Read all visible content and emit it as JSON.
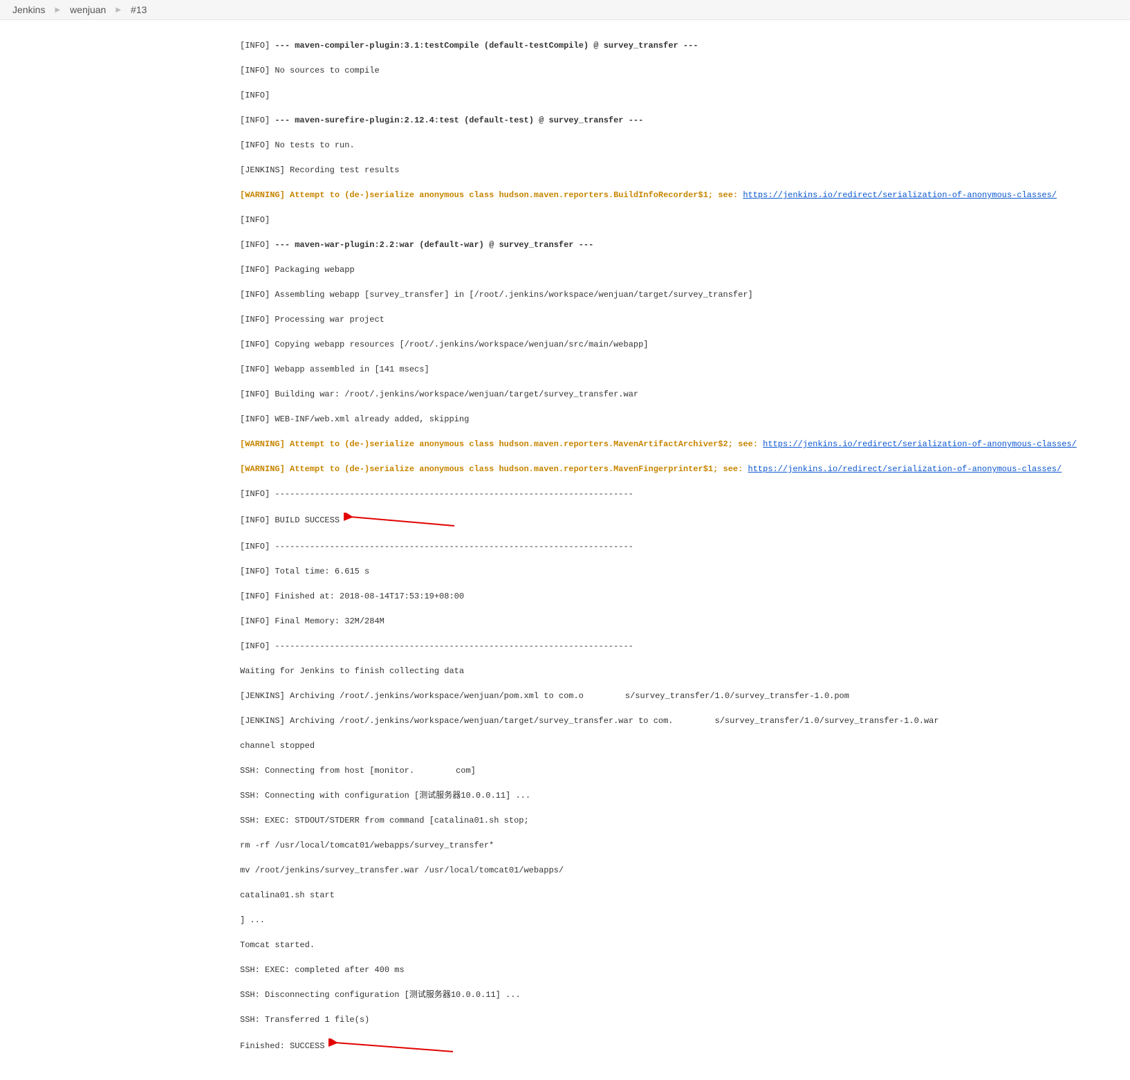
{
  "breadcrumb": {
    "items": [
      "Jenkins",
      "wenjuan",
      "#13"
    ]
  },
  "tags": {
    "info": "[INFO]",
    "jenkins": "[JENKINS]",
    "warning": "[WARNING]"
  },
  "lines": {
    "l1a": "--- ",
    "l1b": "maven-compiler-plugin:3.1:testCompile (default-testCompile) @ survey_transfer",
    "l1c": " ---",
    "l2": "No sources to compile",
    "l3a": "--- ",
    "l3b": "maven-surefire-plugin:2.12.4:test (default-test) @ survey_transfer",
    "l3c": " ---",
    "l4": "No tests to run.",
    "l5": "Recording test results",
    "warn1a": "Attempt to (de-)serialize anonymous class hudson.maven.reporters.BuildInfoRecorder$1; see: ",
    "warnlink": "https://jenkins.io/redirect/serialization-of-anonymous-classes/",
    "l6a": "--- ",
    "l6b": "maven-war-plugin:2.2:war (default-war) @ survey_transfer",
    "l6c": " ---",
    "l7": "Packaging webapp",
    "l8": "Assembling webapp [survey_transfer] in [/root/.jenkins/workspace/wenjuan/target/survey_transfer]",
    "l9": "Processing war project",
    "l10": "Copying webapp resources [/root/.jenkins/workspace/wenjuan/src/main/webapp]",
    "l11": "Webapp assembled in [141 msecs]",
    "l12": "Building war: /root/.jenkins/workspace/wenjuan/target/survey_transfer.war",
    "l13": "WEB-INF/web.xml already added, skipping",
    "warn2a": "Attempt to (de-)serialize anonymous class hudson.maven.reporters.MavenArtifactArchiver$2; see: ",
    "warn3a": "Attempt to (de-)serialize anonymous class hudson.maven.reporters.MavenFingerprinter$1; see: ",
    "dash": "------------------------------------------------------------------------",
    "success": "BUILD SUCCESS",
    "total": "Total time: 6.615 s",
    "finished": "Finished at: 2018-08-14T17:53:19+08:00",
    "memory": "Final Memory: 32M/284M",
    "waiting": "Waiting for Jenkins to finish collecting data",
    "arch1a": "Archiving /root/.jenkins/workspace/wenjuan/pom.xml to com.o",
    "arch1b": "s/survey_transfer/1.0/survey_transfer-1.0.pom",
    "arch2a": "Archiving /root/.jenkins/workspace/wenjuan/target/survey_transfer.war to com.",
    "arch2b": "s/survey_transfer/1.0/survey_transfer-1.0.war",
    "channel": "channel stopped",
    "ssh1a": "SSH: Connecting from host [monitor.",
    "ssh1b": "com]",
    "ssh2": "SSH: Connecting with configuration [测试服务器10.0.0.11] ...",
    "ssh3": "SSH: EXEC: STDOUT/STDERR from command [catalina01.sh stop;",
    "rm": "rm -rf /usr/local/tomcat01/webapps/survey_transfer*",
    "mv": "mv /root/jenkins/survey_transfer.war /usr/local/tomcat01/webapps/",
    "start": "catalina01.sh start",
    "dots": "] ...",
    "tomcat": "Tomcat started.",
    "exec": "SSH: EXEC: completed after 400 ms",
    "disc": "SSH: Disconnecting configuration [测试服务器10.0.0.11] ...",
    "transfer": "SSH: Transferred 1 file(s)",
    "final": "Finished: SUCCESS"
  }
}
